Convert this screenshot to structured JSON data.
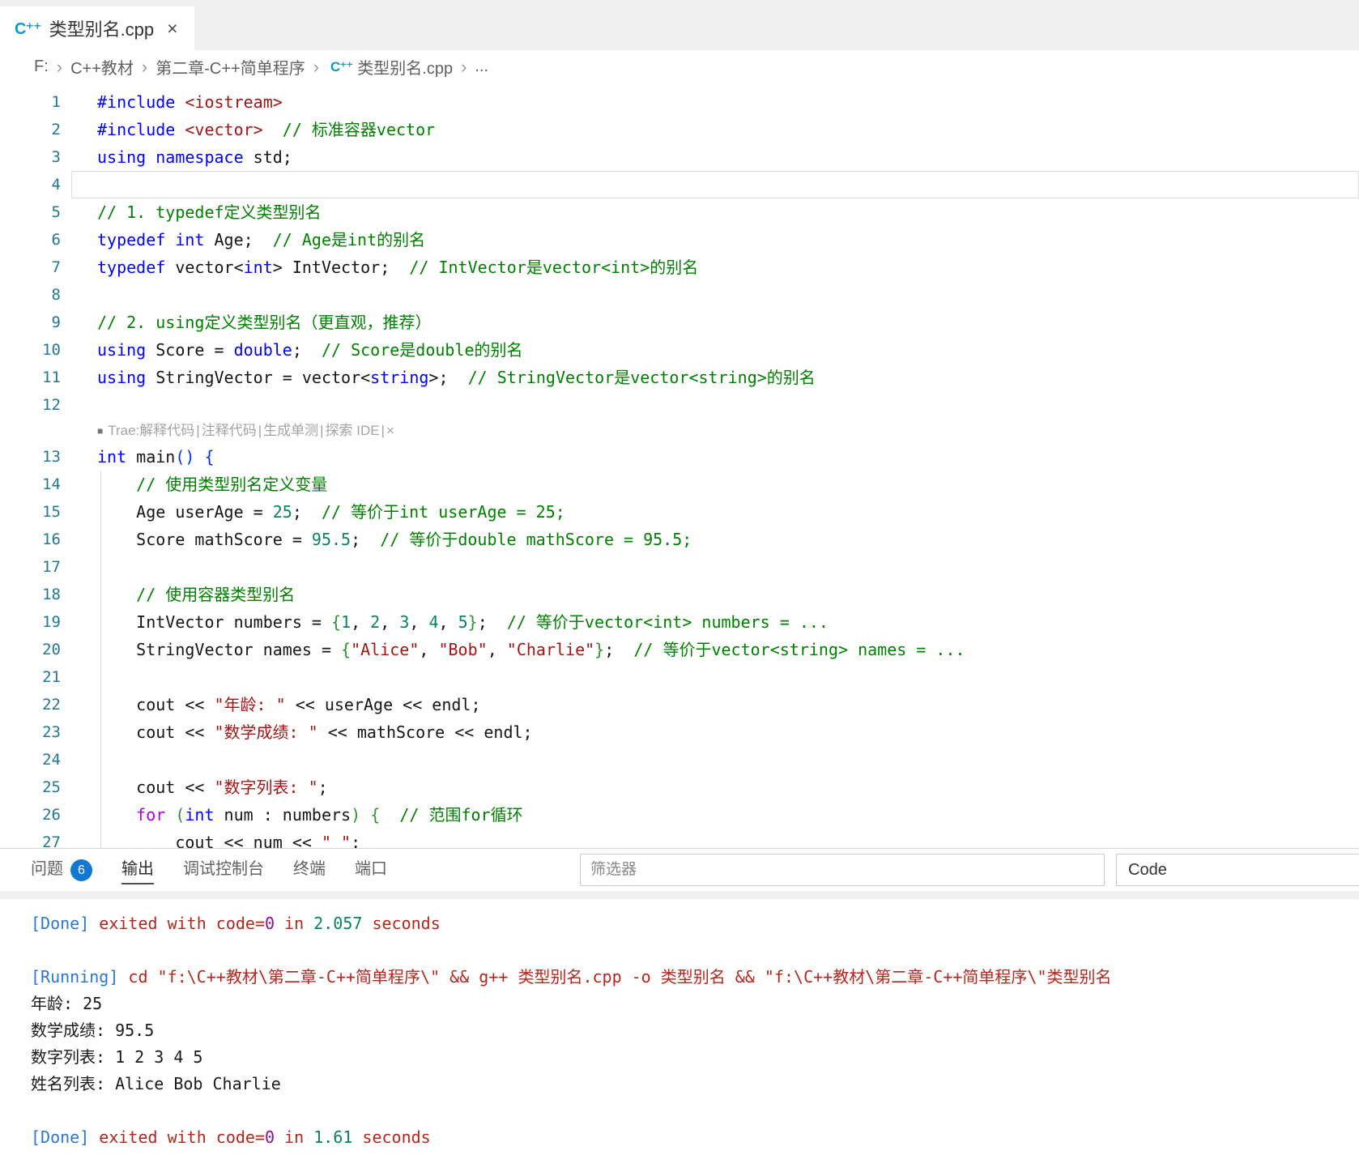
{
  "tab": {
    "title": "类型别名.cpp",
    "close_icon": "×",
    "icon_text": "C⁺⁺"
  },
  "breadcrumb": {
    "separator": "›",
    "items": [
      {
        "label": "F:"
      },
      {
        "label": "C++教材"
      },
      {
        "label": "第二章-C++简单程序"
      },
      {
        "label": "类型别名.cpp",
        "icon": true
      },
      {
        "label": "..."
      }
    ]
  },
  "colors": {
    "keyword": "#0000ff",
    "control_keyword": "#af00db",
    "comment": "#008000",
    "string": "#a31515",
    "number": "#098658",
    "line_number": "#237893",
    "badge": "#1178d4",
    "output_label": "#2e77d0",
    "output_error_text": "#b3271e"
  },
  "editor": {
    "codelens": {
      "icon": "■",
      "prefix": "Trae:",
      "divider": "|",
      "close": "×",
      "items": [
        "解释代码",
        "注释代码",
        "生成单测",
        "探索 IDE"
      ]
    },
    "lines": [
      {
        "n": 1,
        "seg": [
          [
            "kw",
            "#include"
          ],
          [
            "pl",
            " "
          ],
          [
            "str",
            "<iostream>"
          ]
        ]
      },
      {
        "n": 2,
        "seg": [
          [
            "kw",
            "#include"
          ],
          [
            "pl",
            " "
          ],
          [
            "str",
            "<vector>"
          ],
          [
            "pl",
            "  "
          ],
          [
            "cm",
            "// 标准容器vector"
          ]
        ]
      },
      {
        "n": 3,
        "seg": [
          [
            "kw",
            "using namespace"
          ],
          [
            "pl",
            " std;"
          ]
        ]
      },
      {
        "n": 4,
        "cur": true,
        "seg": []
      },
      {
        "n": 5,
        "seg": [
          [
            "cm",
            "// 1. typedef定义类型别名"
          ]
        ]
      },
      {
        "n": 6,
        "seg": [
          [
            "kw",
            "typedef"
          ],
          [
            "pl",
            " "
          ],
          [
            "kw",
            "int"
          ],
          [
            "pl",
            " Age;  "
          ],
          [
            "cm",
            "// Age是int的别名"
          ]
        ]
      },
      {
        "n": 7,
        "seg": [
          [
            "kw",
            "typedef"
          ],
          [
            "pl",
            " vector<"
          ],
          [
            "kw",
            "int"
          ],
          [
            "pl",
            "> IntVector;  "
          ],
          [
            "cm",
            "// IntVector是vector<int>的别名"
          ]
        ]
      },
      {
        "n": 8,
        "seg": []
      },
      {
        "n": 9,
        "seg": [
          [
            "cm",
            "// 2. using定义类型别名（更直观，推荐）"
          ]
        ]
      },
      {
        "n": 10,
        "seg": [
          [
            "kw",
            "using"
          ],
          [
            "pl",
            " Score = "
          ],
          [
            "kw",
            "double"
          ],
          [
            "pl",
            ";  "
          ],
          [
            "cm",
            "// Score是double的别名"
          ]
        ]
      },
      {
        "n": 11,
        "seg": [
          [
            "kw",
            "using"
          ],
          [
            "pl",
            " StringVector = vector<"
          ],
          [
            "kw",
            "string"
          ],
          [
            "pl",
            ">;  "
          ],
          [
            "cm",
            "// StringVector是vector<string>的别名"
          ]
        ]
      },
      {
        "n": 12,
        "seg": []
      },
      {
        "lens": true
      },
      {
        "n": 13,
        "seg": [
          [
            "kw",
            "int"
          ],
          [
            "pl",
            " main"
          ],
          [
            "b1",
            "()"
          ],
          [
            "pl",
            " "
          ],
          [
            "b1",
            "{"
          ]
        ]
      },
      {
        "n": 14,
        "guide": true,
        "seg": [
          [
            "pl",
            "    "
          ],
          [
            "cm",
            "// 使用类型别名定义变量"
          ]
        ]
      },
      {
        "n": 15,
        "guide": true,
        "seg": [
          [
            "pl",
            "    Age userAge = "
          ],
          [
            "num",
            "25"
          ],
          [
            "pl",
            ";  "
          ],
          [
            "cm",
            "// 等价于int userAge = 25;"
          ]
        ]
      },
      {
        "n": 16,
        "guide": true,
        "seg": [
          [
            "pl",
            "    Score mathScore = "
          ],
          [
            "num",
            "95.5"
          ],
          [
            "pl",
            ";  "
          ],
          [
            "cm",
            "// 等价于double mathScore = 95.5;"
          ]
        ]
      },
      {
        "n": 17,
        "guide": true,
        "seg": []
      },
      {
        "n": 18,
        "guide": true,
        "seg": [
          [
            "pl",
            "    "
          ],
          [
            "cm",
            "// 使用容器类型别名"
          ]
        ]
      },
      {
        "n": 19,
        "guide": true,
        "seg": [
          [
            "pl",
            "    IntVector numbers = "
          ],
          [
            "b2",
            "{"
          ],
          [
            "num",
            "1"
          ],
          [
            "pl",
            ", "
          ],
          [
            "num",
            "2"
          ],
          [
            "pl",
            ", "
          ],
          [
            "num",
            "3"
          ],
          [
            "pl",
            ", "
          ],
          [
            "num",
            "4"
          ],
          [
            "pl",
            ", "
          ],
          [
            "num",
            "5"
          ],
          [
            "b2",
            "}"
          ],
          [
            "pl",
            ";  "
          ],
          [
            "cm",
            "// 等价于vector<int> numbers = ..."
          ]
        ]
      },
      {
        "n": 20,
        "guide": true,
        "seg": [
          [
            "pl",
            "    StringVector names = "
          ],
          [
            "b2",
            "{"
          ],
          [
            "str",
            "\"Alice\""
          ],
          [
            "pl",
            ", "
          ],
          [
            "str",
            "\"Bob\""
          ],
          [
            "pl",
            ", "
          ],
          [
            "str",
            "\"Charlie\""
          ],
          [
            "b2",
            "}"
          ],
          [
            "pl",
            ";  "
          ],
          [
            "cm",
            "// 等价于vector<string> names = ..."
          ]
        ]
      },
      {
        "n": 21,
        "guide": true,
        "seg": []
      },
      {
        "n": 22,
        "guide": true,
        "seg": [
          [
            "pl",
            "    cout << "
          ],
          [
            "str",
            "\"年龄: \""
          ],
          [
            "pl",
            " << userAge << endl;"
          ]
        ]
      },
      {
        "n": 23,
        "guide": true,
        "seg": [
          [
            "pl",
            "    cout << "
          ],
          [
            "str",
            "\"数学成绩: \""
          ],
          [
            "pl",
            " << mathScore << endl;"
          ]
        ]
      },
      {
        "n": 24,
        "guide": true,
        "seg": []
      },
      {
        "n": 25,
        "guide": true,
        "seg": [
          [
            "pl",
            "    cout << "
          ],
          [
            "str",
            "\"数字列表: \""
          ],
          [
            "pl",
            ";"
          ]
        ]
      },
      {
        "n": 26,
        "guide": true,
        "seg": [
          [
            "pl",
            "    "
          ],
          [
            "ctl",
            "for"
          ],
          [
            "pl",
            " "
          ],
          [
            "b2",
            "("
          ],
          [
            "kw",
            "int"
          ],
          [
            "pl",
            " num : numbers"
          ],
          [
            "b2",
            ")"
          ],
          [
            "pl",
            " "
          ],
          [
            "b2",
            "{"
          ],
          [
            "pl",
            "  "
          ],
          [
            "cm",
            "// 范围for循环"
          ]
        ]
      },
      {
        "n": 27,
        "guide": true,
        "seg": [
          [
            "pl",
            "        cout << num << "
          ],
          [
            "str",
            "\" \""
          ],
          [
            "pl",
            ";"
          ]
        ]
      }
    ]
  },
  "panel": {
    "tabs": [
      {
        "key": "problems",
        "label": "问题",
        "badge": "6"
      },
      {
        "key": "output",
        "label": "输出",
        "active": true
      },
      {
        "key": "debug-console",
        "label": "调试控制台"
      },
      {
        "key": "terminal",
        "label": "终端"
      },
      {
        "key": "ports",
        "label": "端口"
      }
    ],
    "filter_placeholder": "筛选器",
    "channel": "Code"
  },
  "output": {
    "lines": [
      [
        [
          "o-blue",
          "[Done]"
        ],
        [
          "o-red",
          " exited with code="
        ],
        [
          "o-pur",
          "0"
        ],
        [
          "o-red",
          " in "
        ],
        [
          "o-grn",
          "2.057"
        ],
        [
          "o-red",
          " seconds"
        ]
      ],
      [],
      [
        [
          "o-blue",
          "[Running]"
        ],
        [
          "o-red",
          " cd \"f:\\C++教材\\第二章-C++简单程序\\\" && g++ 类型别名.cpp -o 类型别名 && \"f:\\C++教材\\第二章-C++简单程序\\\"类型别名"
        ]
      ],
      [
        [
          "o-pl",
          "年龄: 25"
        ]
      ],
      [
        [
          "o-pl",
          "数学成绩: 95.5"
        ]
      ],
      [
        [
          "o-pl",
          "数字列表: 1 2 3 4 5"
        ]
      ],
      [
        [
          "o-pl",
          "姓名列表: Alice Bob Charlie"
        ]
      ],
      [],
      [
        [
          "o-blue",
          "[Done]"
        ],
        [
          "o-red",
          " exited with code="
        ],
        [
          "o-pur",
          "0"
        ],
        [
          "o-red",
          " in "
        ],
        [
          "o-grn",
          "1.61"
        ],
        [
          "o-red",
          " seconds"
        ]
      ]
    ]
  }
}
